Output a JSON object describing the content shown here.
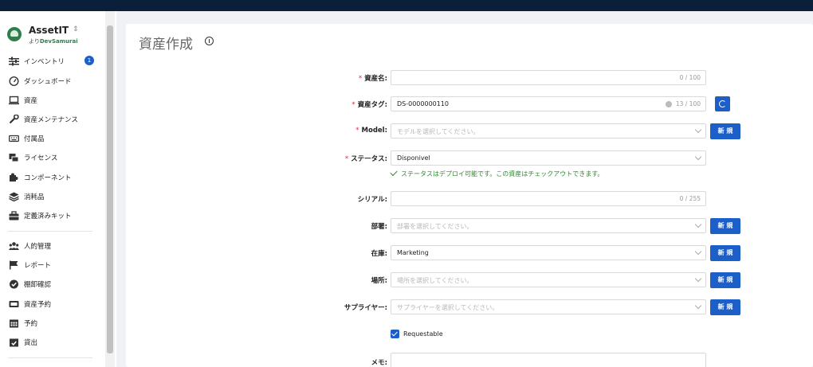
{
  "app": {
    "name": "AssetIT",
    "by": "より",
    "by_brand": "DevSamurai"
  },
  "sidebar": {
    "items": [
      {
        "label": "インベントリ",
        "icon": "sliders-icon",
        "badge": "1"
      },
      {
        "label": "ダッシュボード",
        "icon": "gauge-icon"
      },
      {
        "label": "資産",
        "icon": "laptop-icon"
      },
      {
        "label": "資産メンテナンス",
        "icon": "wrench-icon"
      },
      {
        "label": "付属品",
        "icon": "keyboard-icon"
      },
      {
        "label": "ライセンス",
        "icon": "license-icon"
      },
      {
        "label": "コンポーネント",
        "icon": "puzzle-icon"
      },
      {
        "label": "消耗品",
        "icon": "layers-icon"
      },
      {
        "label": "定義済みキット",
        "icon": "toolbox-icon"
      },
      {
        "label": "人的管理",
        "icon": "users-icon"
      },
      {
        "label": "レポート",
        "icon": "flag-icon"
      },
      {
        "label": "棚卸確認",
        "icon": "badge-check-icon"
      },
      {
        "label": "資産予約",
        "icon": "ticket-icon"
      },
      {
        "label": "予約",
        "icon": "calendar-icon"
      },
      {
        "label": "貸出",
        "icon": "calendar-check-icon"
      }
    ]
  },
  "page": {
    "title": "資産作成"
  },
  "form": {
    "asset_name": {
      "label": "資産名:",
      "value": "",
      "counter": "0 / 100"
    },
    "asset_tag": {
      "label": "資産タグ:",
      "value": "DS-0000000110",
      "counter": "13 / 100"
    },
    "model": {
      "label": "Model:",
      "placeholder": "モデルを選択してください。",
      "new": "新 規"
    },
    "status": {
      "label": "ステータス:",
      "value": "Disponivel",
      "hint": "ステータスはデプロイ可能です。この資産はチェックアウトできます。"
    },
    "serial": {
      "label": "シリアル:",
      "value": "",
      "counter": "0 / 255"
    },
    "department": {
      "label": "部署:",
      "placeholder": "部署を選択してください。",
      "new": "新 規"
    },
    "stock": {
      "label": "在庫:",
      "value": "Marketing",
      "new": "新 規"
    },
    "location": {
      "label": "場所:",
      "placeholder": "場所を選択してください。",
      "new": "新 規"
    },
    "supplier": {
      "label": "サプライヤー:",
      "placeholder": "サプライヤーを選択してください。",
      "new": "新 規"
    },
    "requestable": {
      "label": "Requestable",
      "checked": true
    },
    "memo": {
      "label": "メモ:"
    }
  },
  "colors": {
    "primary": "#1c5fc9",
    "topbar": "#0b1f3a",
    "success": "#2e8b2e",
    "required": "#e0293c",
    "brand": "#2f7d4a"
  }
}
